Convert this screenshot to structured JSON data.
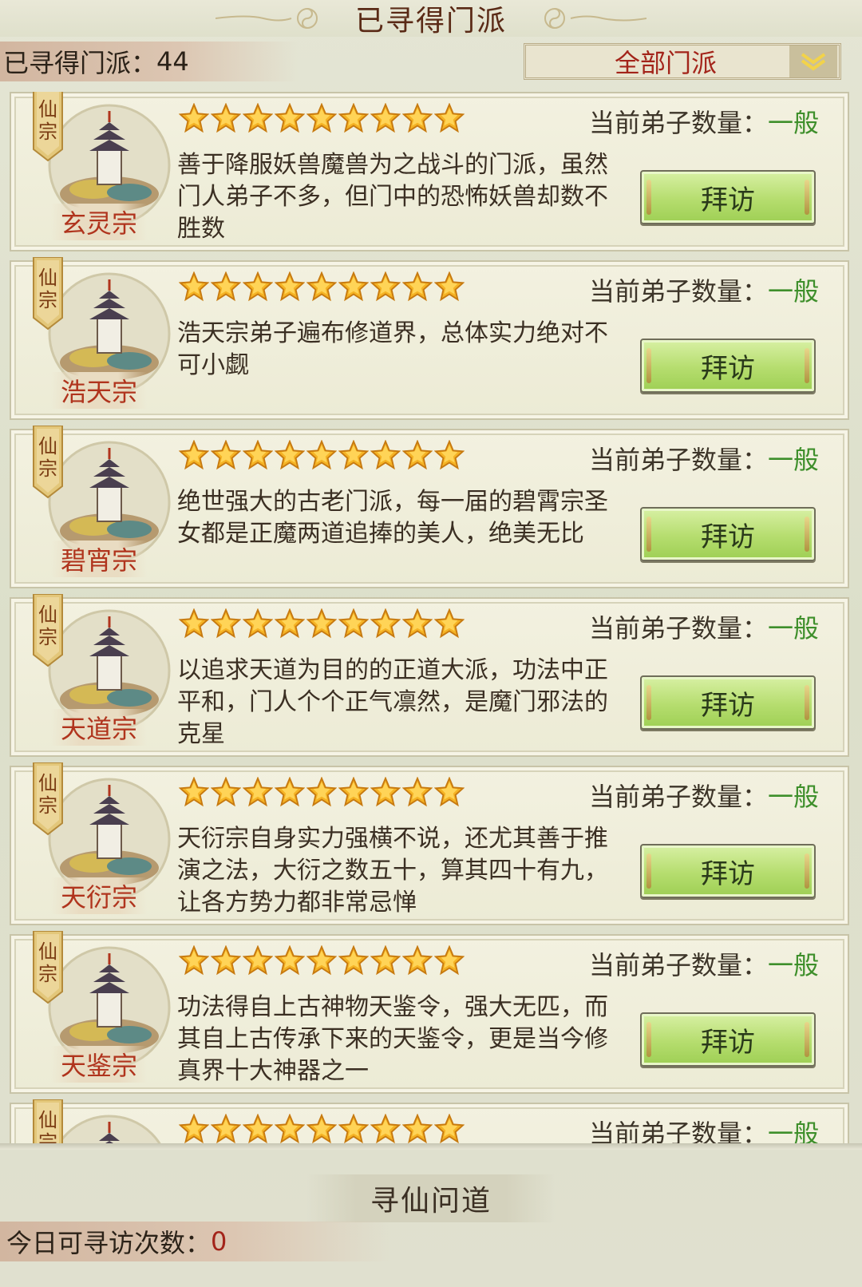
{
  "header": {
    "title": "已寻得门派"
  },
  "count": {
    "label": "已寻得门派：",
    "value": "44"
  },
  "filter": {
    "selected": "全部门派"
  },
  "card_labels": {
    "tag": "仙宗",
    "disciples_label": "当前弟子数量：",
    "visit_button": "拜访"
  },
  "sects": [
    {
      "name": "玄灵宗",
      "stars": 9,
      "disciples": "一般",
      "description": "善于降服妖兽魔兽为之战斗的门派，虽然门人弟子不多，但门中的恐怖妖兽却数不胜数"
    },
    {
      "name": "浩天宗",
      "stars": 9,
      "disciples": "一般",
      "description": "浩天宗弟子遍布修道界，总体实力绝对不可小觑"
    },
    {
      "name": "碧宵宗",
      "stars": 9,
      "disciples": "一般",
      "description": "绝世强大的古老门派，每一届的碧霄宗圣女都是正魔两道追捧的美人，绝美无比"
    },
    {
      "name": "天道宗",
      "stars": 9,
      "disciples": "一般",
      "description": "以追求天道为目的的正道大派，功法中正平和，门人个个正气凛然，是魔门邪法的克星"
    },
    {
      "name": "天衍宗",
      "stars": 9,
      "disciples": "一般",
      "description": "天衍宗自身实力强横不说，还尤其善于推演之法，大衍之数五十，算其四十有九，让各方势力都非常忌惮"
    },
    {
      "name": "天鉴宗",
      "stars": 9,
      "disciples": "一般",
      "description": "功法得自上古神物天鉴令，强大无匹，而其自上古传承下来的天鉴令，更是当今修真界十大神器之一"
    },
    {
      "name": "",
      "stars": 9,
      "disciples": "一般",
      "description": ""
    }
  ],
  "seek": {
    "title": "寻仙问道",
    "today_label": "今日可寻访次数：",
    "today_value": "0"
  },
  "colors": {
    "title": "#5a2a16",
    "sect_name": "#b0341d",
    "level_green": "#3e8f2b",
    "button_green": "#b5dd6e",
    "star_gold": "#f5b324"
  },
  "icons": {
    "star": "star-icon",
    "dropdown": "chevron-down-icon",
    "emblem": "pagoda-emblem-icon"
  }
}
